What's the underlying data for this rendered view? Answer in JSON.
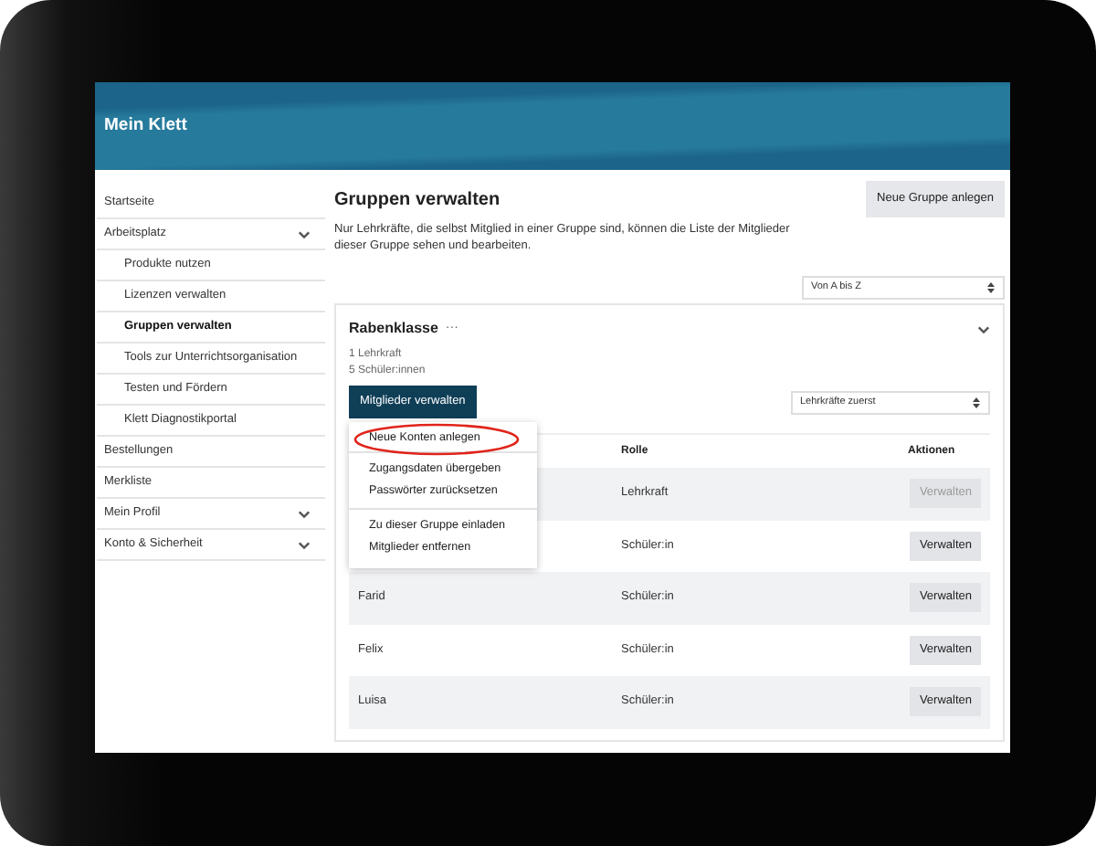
{
  "header": {
    "title": "Mein Klett"
  },
  "sidebar": {
    "items": [
      {
        "label": "Startseite",
        "selected": false,
        "kind": "link"
      },
      {
        "label": "Arbeitsplatz",
        "selected": false,
        "kind": "expandable",
        "children": [
          {
            "label": "Produkte nutzen",
            "selected": false
          },
          {
            "label": "Lizenzen verwalten",
            "selected": false
          },
          {
            "label": "Gruppen verwalten",
            "selected": true
          },
          {
            "label": "Tools zur Unterrichtsorganisation",
            "selected": false
          },
          {
            "label": "Testen und Fördern",
            "selected": false
          },
          {
            "label": "Klett Diagnostikportal",
            "selected": false
          }
        ]
      },
      {
        "label": "Bestellungen",
        "selected": false,
        "kind": "link"
      },
      {
        "label": "Merkliste",
        "selected": false,
        "kind": "link"
      },
      {
        "label": "Mein Profil",
        "selected": false,
        "kind": "expandable"
      },
      {
        "label": "Konto & Sicherheit",
        "selected": false,
        "kind": "expandable"
      }
    ]
  },
  "page": {
    "title": "Gruppen verwalten",
    "description": "Nur Lehrkräfte, die selbst Mitglied in einer Gruppe sind, können die Liste der Mitglieder dieser Gruppe sehen und bearbeiten.",
    "new_group_button": "Neue Gruppe anlegen",
    "sort_select": "Von A bis Z"
  },
  "group": {
    "name": "Rabenklasse",
    "more": "···",
    "expanded": true,
    "counts": [
      "1 Lehrkraft",
      "5 Schüler:innen"
    ],
    "members_button": "Mitglieder verwalten",
    "member_sort_select": "Lehrkräfte zuerst",
    "menu": {
      "sections": [
        {
          "items": [
            {
              "label": "Neue Konten anlegen",
              "highlighted": true
            }
          ]
        },
        {
          "items": [
            {
              "label": "Zugangsdaten übergeben",
              "highlighted": false
            },
            {
              "label": "Passwörter zurücksetzen",
              "highlighted": false
            }
          ]
        },
        {
          "items": [
            {
              "label": "Zu dieser Gruppe einladen",
              "highlighted": false
            },
            {
              "label": "Mitglieder entfernen",
              "highlighted": false
            }
          ]
        }
      ]
    },
    "table": {
      "columns": [
        "Rolle",
        "Aktionen"
      ],
      "rows": [
        {
          "role": "Lehrkraft",
          "action": "Verwalten",
          "disabled": true
        },
        {
          "role": "Schüler:in",
          "action": "Verwalten",
          "disabled": false
        },
        {
          "name": "Farid",
          "role": "Schüler:in",
          "action": "Verwalten",
          "disabled": false
        },
        {
          "name": "Felix",
          "role": "Schüler:in",
          "action": "Verwalten",
          "disabled": false
        },
        {
          "name": "Luisa",
          "role": "Schüler:in",
          "action": "Verwalten",
          "disabled": false
        }
      ]
    }
  }
}
